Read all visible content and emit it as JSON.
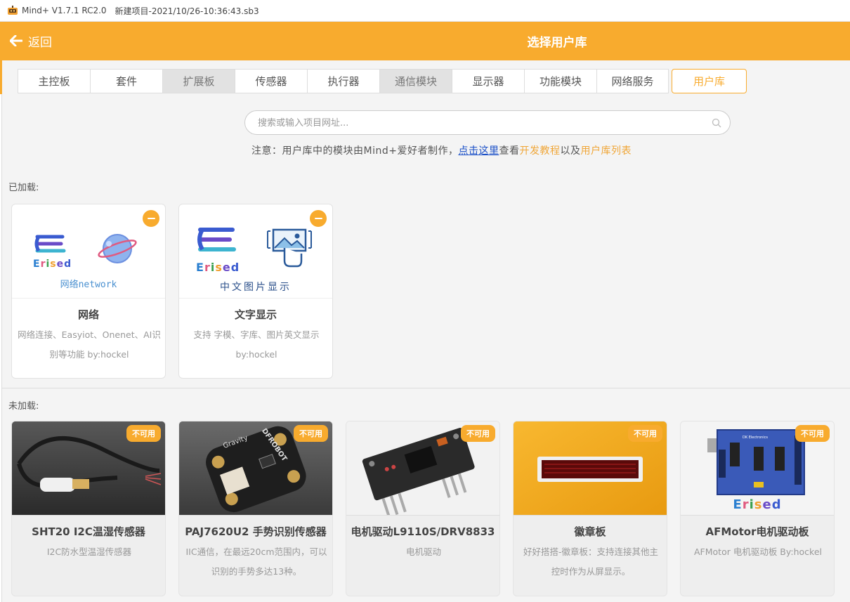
{
  "window": {
    "app_name": "Mind+ V1.7.1 RC2.0",
    "project": "新建项目-2021/10/26-10:36:43.sb3"
  },
  "header": {
    "back_label": "返回",
    "title": "选择用户库"
  },
  "tabs": [
    {
      "label": "主控板"
    },
    {
      "label": "套件"
    },
    {
      "label": "扩展板"
    },
    {
      "label": "传感器"
    },
    {
      "label": "执行器"
    },
    {
      "label": "通信模块"
    },
    {
      "label": "显示器"
    },
    {
      "label": "功能模块"
    },
    {
      "label": "网络服务"
    },
    {
      "label": "用户库"
    }
  ],
  "search": {
    "placeholder": "搜索或输入项目网址..."
  },
  "notice": {
    "prefix": "注意：用户库中的模块由Mind+爱好者制作，",
    "link": "点击这里",
    "middle": "查看",
    "tutorial": "开发教程",
    "and": "以及",
    "list": "用户库列表"
  },
  "loaded": {
    "label": "已加载:",
    "cards": [
      {
        "name": "网络",
        "desc": "网络连接、Easyiot、Onenet、AI识别等功能 by:hockel",
        "logo_text": "Erised",
        "caption": "网络network"
      },
      {
        "name": "文字显示",
        "desc": "支持 字模、字库、图片英文显示 by:hockel",
        "logo_text": "Erised",
        "caption": "中文图片显示"
      }
    ]
  },
  "unloaded": {
    "label": "未加载:",
    "badge": "不可用",
    "cards": [
      {
        "name": "SHT20 I2C温湿传感器",
        "desc": "I2C防水型温湿传感器"
      },
      {
        "name": "PAJ7620U2 手势识别传感器",
        "desc": "IIC通信，在最远20cm范围内，可以识别的手势多达13种。",
        "board_label": "Gravity",
        "brand": "DFROBOT"
      },
      {
        "name": "电机驱动L9110S/DRV8833",
        "desc": "电机驱动"
      },
      {
        "name": "徽章板",
        "desc": "好好搭搭-徽章板：支持连接其他主控时作为从屏显示。"
      },
      {
        "name": "AFMotor电机驱动板",
        "desc": "AFMotor 电机驱动板 By:hockel",
        "logo_text": "Erised",
        "board_text": "DK Electronics"
      }
    ]
  },
  "colors": {
    "accent": "#f8ab2e",
    "link": "#1a4fc7"
  }
}
